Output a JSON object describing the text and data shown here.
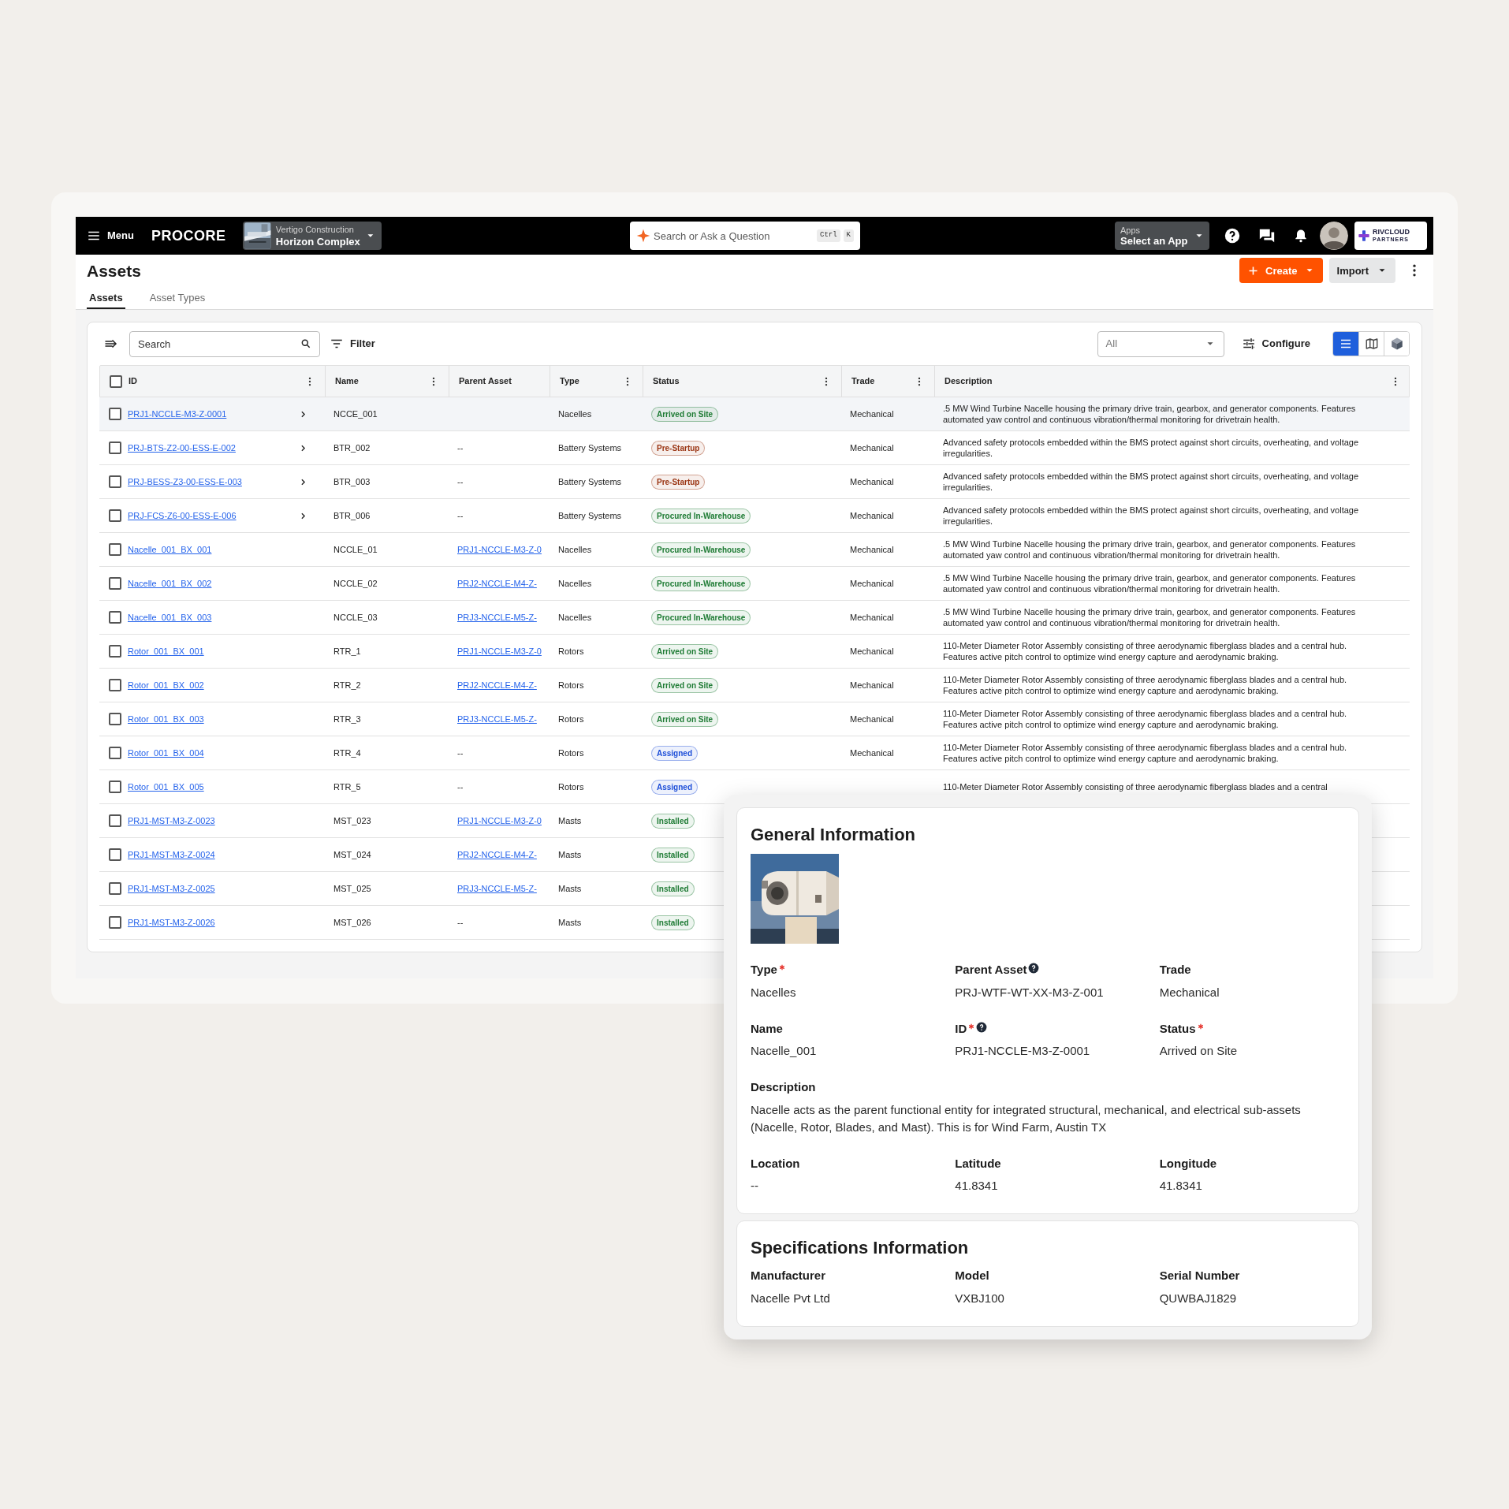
{
  "top_bar": {
    "menu_label": "Menu",
    "brand": "PROCORE",
    "project": {
      "company": "Vertigo Construction",
      "name": "Horizon Complex"
    },
    "search": {
      "placeholder": "Search or Ask a Question",
      "shortcut": [
        "Ctrl",
        "K"
      ]
    },
    "apps": {
      "label": "Apps",
      "value": "Select an App"
    },
    "partner_logo": {
      "name": "RIVCLOUD",
      "tagline": "PARTNERS"
    }
  },
  "page": {
    "title": "Assets",
    "actions": [
      {
        "label": "Create",
        "kind": "primary"
      },
      {
        "label": "Import",
        "kind": "secondary"
      }
    ],
    "tabs": [
      {
        "label": "Assets",
        "selected": true
      },
      {
        "label": "Asset Types",
        "selected": false
      }
    ]
  },
  "toolbar": {
    "search": {
      "placeholder": "Search"
    },
    "filter_label": "Filter",
    "scope": {
      "value": "All"
    },
    "configure_label": "Configure",
    "views": [
      {
        "kind": "list",
        "selected": true
      },
      {
        "kind": "map",
        "selected": false
      },
      {
        "kind": "model",
        "selected": false
      }
    ]
  },
  "table": {
    "select_all": {
      "checked": false
    },
    "columns": [
      {
        "label": "ID",
        "menu": true
      },
      {
        "label": "Name",
        "menu": true
      },
      {
        "label": "Parent Asset",
        "menu": false
      },
      {
        "label": "Type",
        "menu": true
      },
      {
        "label": "Status",
        "menu": true
      },
      {
        "label": "Trade",
        "menu": true
      },
      {
        "label": "Description",
        "menu": true
      }
    ],
    "rows": [
      {
        "id": "PRJ1-NCCLE-M3-Z-0001",
        "expandable": true,
        "hovered": true,
        "name": "NCCE_001",
        "type": "Nacelles",
        "status": {
          "label": "Arrived on Site",
          "color": "#1e7b34"
        },
        "trade": "Mechanical",
        "description": ".5 MW Wind Turbine Nacelle housing the primary drive train, gearbox, and generator components. Features automated yaw control and continuous vibration/thermal monitoring for drivetrain health."
      },
      {
        "id": "PRJ-BTS-Z2-00-ESS-E-002",
        "expandable": true,
        "hovered": false,
        "name": "BTR_002",
        "parent": "--",
        "parent_link": false,
        "type": "Battery Systems",
        "status": {
          "label": "Pre-Startup",
          "color": "#9a3412"
        },
        "trade": "Mechanical",
        "description": "Advanced safety protocols embedded within the BMS protect against short circuits, overheating, and voltage irregularities."
      },
      {
        "id": "PRJ-BESS-Z3-00-ESS-E-003",
        "expandable": true,
        "hovered": false,
        "name": "BTR_003",
        "parent": "--",
        "parent_link": false,
        "type": "Battery Systems",
        "status": {
          "label": "Pre-Startup",
          "color": "#9a3412"
        },
        "trade": "Mechanical",
        "description": "Advanced safety protocols embedded within the BMS protect against short circuits, overheating, and voltage irregularities."
      },
      {
        "id": "PRJ-FCS-Z6-00-ESS-E-006",
        "expandable": true,
        "hovered": false,
        "name": "BTR_006",
        "parent": "--",
        "parent_link": false,
        "type": "Battery Systems",
        "status": {
          "label": "Procured In-Warehouse",
          "color": "#1e7b34"
        },
        "trade": "Mechanical",
        "description": "Advanced safety protocols embedded within the BMS protect against short circuits, overheating, and voltage irregularities."
      },
      {
        "id": "Nacelle_001_BX_001",
        "expandable": false,
        "hovered": false,
        "name": "NCCLE_01",
        "parent": "PRJ1-NCCLE-M3-Z-0",
        "parent_link": true,
        "type": "Nacelles",
        "status": {
          "label": "Procured In-Warehouse",
          "color": "#1e7b34"
        },
        "trade": "Mechanical",
        "description": ".5 MW Wind Turbine Nacelle housing the primary drive train, gearbox, and generator components. Features automated yaw control and continuous vibration/thermal monitoring for drivetrain health."
      },
      {
        "id": "Nacelle_001_BX_002",
        "expandable": false,
        "hovered": false,
        "name": "NCCLE_02",
        "parent": "PRJ2-NCCLE-M4-Z-",
        "parent_link": true,
        "type": "Nacelles",
        "status": {
          "label": "Procured In-Warehouse",
          "color": "#1e7b34"
        },
        "trade": "Mechanical",
        "description": ".5 MW Wind Turbine Nacelle housing the primary drive train, gearbox, and generator components. Features automated yaw control and continuous vibration/thermal monitoring for drivetrain health."
      },
      {
        "id": "Nacelle_001_BX_003",
        "expandable": false,
        "hovered": false,
        "name": "NCCLE_03",
        "parent": "PRJ3-NCCLE-M5-Z-",
        "parent_link": true,
        "type": "Nacelles",
        "status": {
          "label": "Procured In-Warehouse",
          "color": "#1e7b34"
        },
        "trade": "Mechanical",
        "description": ".5 MW Wind Turbine Nacelle housing the primary drive train, gearbox, and generator components. Features automated yaw control and continuous vibration/thermal monitoring for drivetrain health."
      },
      {
        "id": "Rotor_001_BX_001",
        "expandable": false,
        "hovered": false,
        "name": "RTR_1",
        "parent": "PRJ1-NCCLE-M3-Z-0",
        "parent_link": true,
        "type": "Rotors",
        "status": {
          "label": "Arrived on Site",
          "color": "#1e7b34"
        },
        "trade": "Mechanical",
        "description": "110-Meter Diameter Rotor Assembly consisting of three aerodynamic fiberglass blades and a central hub. Features active pitch control to optimize wind energy capture and aerodynamic braking."
      },
      {
        "id": "Rotor_001_BX_002",
        "expandable": false,
        "hovered": false,
        "name": "RTR_2",
        "parent": "PRJ2-NCCLE-M4-Z-",
        "parent_link": true,
        "type": "Rotors",
        "status": {
          "label": "Arrived on Site",
          "color": "#1e7b34"
        },
        "trade": "Mechanical",
        "description": "110-Meter Diameter Rotor Assembly consisting of three aerodynamic fiberglass blades and a central hub. Features active pitch control to optimize wind energy capture and aerodynamic braking."
      },
      {
        "id": "Rotor_001_BX_003",
        "expandable": false,
        "hovered": false,
        "name": "RTR_3",
        "parent": "PRJ3-NCCLE-M5-Z-",
        "parent_link": true,
        "type": "Rotors",
        "status": {
          "label": "Arrived on Site",
          "color": "#1e7b34"
        },
        "trade": "Mechanical",
        "description": "110-Meter Diameter Rotor Assembly consisting of three aerodynamic fiberglass blades and a central hub. Features active pitch control to optimize wind energy capture and aerodynamic braking."
      },
      {
        "id": "Rotor_001_BX_004",
        "expandable": false,
        "hovered": false,
        "name": "RTR_4",
        "parent": "--",
        "parent_link": false,
        "type": "Rotors",
        "status": {
          "label": "Assigned",
          "color": "#1d4ed8"
        },
        "trade": "Mechanical",
        "description": "110-Meter Diameter Rotor Assembly consisting of three aerodynamic fiberglass blades and a central hub. Features active pitch control to optimize wind energy capture and aerodynamic braking."
      },
      {
        "id": "Rotor_001_BX_005",
        "expandable": false,
        "hovered": false,
        "name": "RTR_5",
        "parent": "--",
        "parent_link": false,
        "type": "Rotors",
        "status": {
          "label": "Assigned",
          "color": "#1d4ed8"
        },
        "description": "110-Meter Diameter Rotor Assembly consisting of three aerodynamic fiberglass blades and a central"
      },
      {
        "id": "PRJ1-MST-M3-Z-0023",
        "expandable": false,
        "hovered": false,
        "name": "MST_023",
        "parent": "PRJ1-NCCLE-M3-Z-0",
        "parent_link": true,
        "type": "Masts",
        "status": {
          "label": "Installed",
          "color": "#1e7b34"
        }
      },
      {
        "id": "PRJ1-MST-M3-Z-0024",
        "expandable": false,
        "hovered": false,
        "name": "MST_024",
        "parent": "PRJ2-NCCLE-M4-Z-",
        "parent_link": true,
        "type": "Masts",
        "status": {
          "label": "Installed",
          "color": "#1e7b34"
        }
      },
      {
        "id": "PRJ1-MST-M3-Z-0025",
        "expandable": false,
        "hovered": false,
        "name": "MST_025",
        "parent": "PRJ3-NCCLE-M5-Z-",
        "parent_link": true,
        "type": "Masts",
        "status": {
          "label": "Installed",
          "color": "#1e7b34"
        }
      },
      {
        "id": "PRJ1-MST-M3-Z-0026",
        "expandable": false,
        "hovered": false,
        "name": "MST_026",
        "parent": "--",
        "parent_link": false,
        "type": "Masts",
        "status": {
          "label": "Installed",
          "color": "#1e7b34"
        }
      }
    ]
  },
  "detail": {
    "sections": [
      {
        "title": "General Information",
        "fields": [
          {
            "kind": "field",
            "label": "Type",
            "value": "Nacelles",
            "required": true,
            "help": false
          },
          {
            "kind": "field",
            "label": "Parent Asset",
            "value": "PRJ-WTF-WT-XX-M3-Z-001",
            "required": false,
            "help": true
          },
          {
            "kind": "field",
            "label": "Trade",
            "value": "Mechanical",
            "required": false,
            "help": false
          },
          {
            "kind": "field",
            "label": "Name",
            "value": "Nacelle_001",
            "required": false,
            "help": false
          },
          {
            "kind": "field",
            "label": "ID",
            "value": "PRJ1-NCCLE-M3-Z-0001",
            "required": true,
            "help": true
          },
          {
            "kind": "field",
            "label": "Status",
            "value": "Arrived on Site",
            "required": true,
            "help": false
          },
          {
            "kind": "wide",
            "label": "Description",
            "value": "Nacelle acts as the parent functional entity for integrated structural, mechanical, and electrical sub-assets (Nacelle, Rotor, Blades, and Mast). This is for Wind Farm, Austin TX",
            "required": false,
            "help": false
          },
          {
            "kind": "field",
            "label": "Location",
            "value": "--",
            "required": false,
            "help": false
          },
          {
            "kind": "field",
            "label": "Latitude",
            "value": "41.8341",
            "required": false,
            "help": false
          },
          {
            "kind": "field",
            "label": "Longitude",
            "value": "41.8341",
            "required": false,
            "help": false
          }
        ]
      },
      {
        "title": "Specifications Information",
        "fields": [
          {
            "kind": "field",
            "label": "Manufacturer",
            "value": "Nacelle Pvt Ltd",
            "required": false,
            "help": false
          },
          {
            "kind": "field",
            "label": "Model",
            "value": "VXBJ100",
            "required": false,
            "help": false
          },
          {
            "kind": "field",
            "label": "Serial Number",
            "value": "QUWBAJ1829",
            "required": false,
            "help": false
          }
        ]
      }
    ]
  }
}
